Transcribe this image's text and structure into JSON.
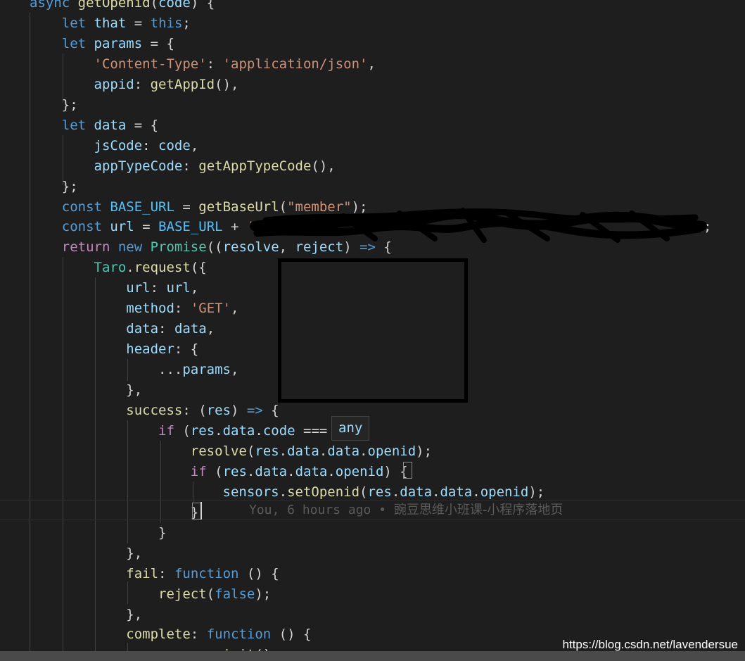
{
  "colors": {
    "background": "#1e1e1e",
    "keyword": "#569cd6",
    "control": "#c586c0",
    "variable": "#9cdcfe",
    "function": "#dcdcaa",
    "string": "#ce9178",
    "class": "#4ec9b0",
    "punctuation": "#d4d4d4",
    "blame": "#5a5a5a"
  },
  "code": {
    "lines": [
      [
        [
          "kw",
          "async "
        ],
        [
          "fn",
          "getOpenid"
        ],
        [
          "pun",
          "("
        ],
        [
          "var",
          "code"
        ],
        [
          "pun",
          ") {"
        ]
      ],
      [
        [
          "pun",
          "    "
        ],
        [
          "kw",
          "let "
        ],
        [
          "var",
          "that"
        ],
        [
          "pun",
          " = "
        ],
        [
          "kw",
          "this"
        ],
        [
          "pun",
          ";"
        ]
      ],
      [
        [
          "pun",
          "    "
        ],
        [
          "kw",
          "let "
        ],
        [
          "var",
          "params"
        ],
        [
          "pun",
          " = {"
        ]
      ],
      [
        [
          "pun",
          "        "
        ],
        [
          "str",
          "'Content-Type'"
        ],
        [
          "pun",
          ": "
        ],
        [
          "str",
          "'application/json'"
        ],
        [
          "pun",
          ","
        ]
      ],
      [
        [
          "pun",
          "        "
        ],
        [
          "var",
          "appid"
        ],
        [
          "pun",
          ": "
        ],
        [
          "fn",
          "getAppId"
        ],
        [
          "pun",
          "(),"
        ]
      ],
      [
        [
          "pun",
          "    };"
        ]
      ],
      [
        [
          "pun",
          "    "
        ],
        [
          "kw",
          "let "
        ],
        [
          "var",
          "data"
        ],
        [
          "pun",
          " = {"
        ]
      ],
      [
        [
          "pun",
          "        "
        ],
        [
          "var",
          "jsCode"
        ],
        [
          "pun",
          ": "
        ],
        [
          "var",
          "code"
        ],
        [
          "pun",
          ","
        ]
      ],
      [
        [
          "pun",
          "        "
        ],
        [
          "var",
          "appTypeCode"
        ],
        [
          "pun",
          ": "
        ],
        [
          "fn",
          "getAppTypeCode"
        ],
        [
          "pun",
          "(),"
        ]
      ],
      [
        [
          "pun",
          "    };"
        ]
      ],
      [
        [
          "pun",
          "    "
        ],
        [
          "kw",
          "const "
        ],
        [
          "const",
          "BASE_URL"
        ],
        [
          "pun",
          " = "
        ],
        [
          "fn",
          "getBaseUrl"
        ],
        [
          "pun",
          "("
        ],
        [
          "str",
          "\"member\""
        ],
        [
          "pun",
          ");"
        ]
      ],
      [
        [
          "pun",
          "    "
        ],
        [
          "kw",
          "const "
        ],
        [
          "var",
          "url"
        ],
        [
          "pun",
          " = "
        ],
        [
          "const",
          "BASE_URL"
        ],
        [
          "pun",
          " + "
        ],
        [
          "str",
          "'/"
        ]
      ],
      [
        [
          "pun",
          "    "
        ],
        [
          "ctrl",
          "return "
        ],
        [
          "kw",
          "new "
        ],
        [
          "cls",
          "Promise"
        ],
        [
          "pun",
          "(("
        ],
        [
          "var",
          "resolve"
        ],
        [
          "pun",
          ", "
        ],
        [
          "var",
          "reject"
        ],
        [
          "pun",
          ") "
        ],
        [
          "kw",
          "=>"
        ],
        [
          "pun",
          " {"
        ]
      ],
      [
        [
          "pun",
          "        "
        ],
        [
          "cls",
          "Taro"
        ],
        [
          "pun",
          "."
        ],
        [
          "fn",
          "request"
        ],
        [
          "pun",
          "({"
        ]
      ],
      [
        [
          "pun",
          "            "
        ],
        [
          "var",
          "url"
        ],
        [
          "pun",
          ": "
        ],
        [
          "var",
          "url"
        ],
        [
          "pun",
          ","
        ]
      ],
      [
        [
          "pun",
          "            "
        ],
        [
          "var",
          "method"
        ],
        [
          "pun",
          ": "
        ],
        [
          "str",
          "'GET'"
        ],
        [
          "pun",
          ","
        ]
      ],
      [
        [
          "pun",
          "            "
        ],
        [
          "var",
          "data"
        ],
        [
          "pun",
          ": "
        ],
        [
          "var",
          "data"
        ],
        [
          "pun",
          ","
        ]
      ],
      [
        [
          "pun",
          "            "
        ],
        [
          "var",
          "header"
        ],
        [
          "pun",
          ": {"
        ]
      ],
      [
        [
          "pun",
          "                ..."
        ],
        [
          "var",
          "params"
        ],
        [
          "pun",
          ","
        ]
      ],
      [
        [
          "pun",
          "            },"
        ]
      ],
      [
        [
          "pun",
          "            "
        ],
        [
          "fn",
          "success"
        ],
        [
          "pun",
          ": ("
        ],
        [
          "var",
          "res"
        ],
        [
          "pun",
          ") "
        ],
        [
          "kw",
          "=>"
        ],
        [
          "pun",
          " {"
        ]
      ],
      [
        [
          "pun",
          "                "
        ],
        [
          "ctrl",
          "if "
        ],
        [
          "pun",
          "("
        ],
        [
          "var",
          "res"
        ],
        [
          "pun",
          "."
        ],
        [
          "var",
          "data"
        ],
        [
          "pun",
          "."
        ],
        [
          "var",
          "code"
        ],
        [
          "pun",
          " ==="
        ]
      ],
      [
        [
          "pun",
          "                    "
        ],
        [
          "fn",
          "resolve"
        ],
        [
          "pun",
          "("
        ],
        [
          "var",
          "res"
        ],
        [
          "pun",
          "."
        ],
        [
          "var",
          "data"
        ],
        [
          "pun",
          "."
        ],
        [
          "var",
          "data"
        ],
        [
          "pun",
          "."
        ],
        [
          "var",
          "openid"
        ],
        [
          "pun",
          ");"
        ]
      ],
      [
        [
          "pun",
          "                    "
        ],
        [
          "ctrl",
          "if "
        ],
        [
          "pun",
          "("
        ],
        [
          "var",
          "res"
        ],
        [
          "pun",
          "."
        ],
        [
          "var",
          "data"
        ],
        [
          "pun",
          "."
        ],
        [
          "var",
          "data"
        ],
        [
          "pun",
          "."
        ],
        [
          "var",
          "openid"
        ],
        [
          "pun",
          ") {"
        ]
      ],
      [
        [
          "pun",
          "                        "
        ],
        [
          "var",
          "sensors"
        ],
        [
          "pun",
          "."
        ],
        [
          "fn",
          "setOpenid"
        ],
        [
          "pun",
          "("
        ],
        [
          "var",
          "res"
        ],
        [
          "pun",
          "."
        ],
        [
          "var",
          "data"
        ],
        [
          "pun",
          "."
        ],
        [
          "var",
          "data"
        ],
        [
          "pun",
          "."
        ],
        [
          "var",
          "openid"
        ],
        [
          "pun",
          ");"
        ]
      ],
      [
        [
          "pun",
          "                    }"
        ]
      ],
      [
        [
          "pun",
          "                }"
        ]
      ],
      [
        [
          "pun",
          "            },"
        ]
      ],
      [
        [
          "pun",
          "            "
        ],
        [
          "fn",
          "fail"
        ],
        [
          "pun",
          ": "
        ],
        [
          "kw",
          "function"
        ],
        [
          "pun",
          " () {"
        ]
      ],
      [
        [
          "pun",
          "                "
        ],
        [
          "fn",
          "reject"
        ],
        [
          "pun",
          "("
        ],
        [
          "kw",
          "false"
        ],
        [
          "pun",
          ");"
        ]
      ],
      [
        [
          "pun",
          "            },"
        ]
      ],
      [
        [
          "pun",
          "            "
        ],
        [
          "fn",
          "complete"
        ],
        [
          "pun",
          ": "
        ],
        [
          "kw",
          "function"
        ],
        [
          "pun",
          " () {"
        ]
      ],
      [
        [
          "pun",
          "                "
        ],
        [
          "var",
          "sensors"
        ],
        [
          "pun",
          "."
        ],
        [
          "fn",
          "init"
        ],
        [
          "pun",
          "();"
        ]
      ]
    ],
    "line_11_tail": ";"
  },
  "blame": {
    "author_time": "You, 6 hours ago • ",
    "message": "豌豆思维小班课-小程序落地页"
  },
  "hover": {
    "type_text": "any"
  },
  "watermark": "https://blog.csdn.net/lavendersue"
}
